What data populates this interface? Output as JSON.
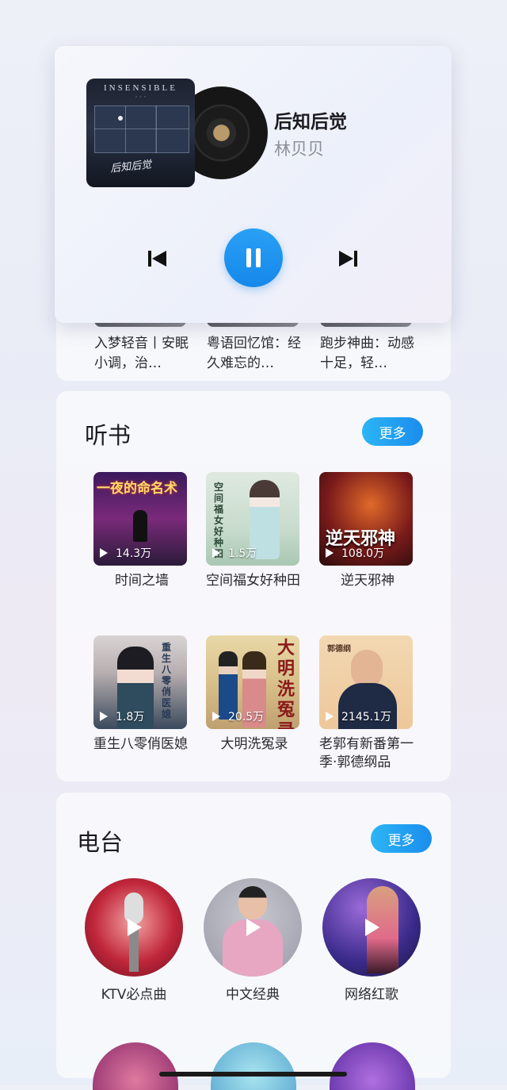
{
  "playlists": [
    {
      "title": "入梦轻音丨安眠小调，治…"
    },
    {
      "title": "粤语回忆馆：经久难忘的…"
    },
    {
      "title": "跑步神曲：动感十足，轻…"
    }
  ],
  "player": {
    "album_brand": "INSENSIBLE",
    "album_script": "后知后觉",
    "song_title": "后知后觉",
    "artist": "林贝贝",
    "prev_icon": "skip-previous-icon",
    "play_icon": "pause-icon",
    "next_icon": "skip-next-icon",
    "accent": "#1a8ded"
  },
  "books": {
    "title": "听书",
    "more": "更多",
    "items": [
      {
        "title": "时间之墙",
        "plays": "14.3万",
        "cover_text": "一夜的命名术"
      },
      {
        "title": "空间福女好种田",
        "plays": "1.5万",
        "cover_text": "空间福女好种田"
      },
      {
        "title": "逆天邪神",
        "plays": "108.0万",
        "cover_text": "逆天邪神"
      },
      {
        "title": "重生八零俏医媳",
        "plays": "1.8万",
        "cover_text": "重生八零俏医媳"
      },
      {
        "title": "大明洗冤录",
        "plays": "20.5万",
        "cover_text": "大明洗冤录"
      },
      {
        "title": "老郭有新番第一季·郭德纲品",
        "plays": "2145.1万",
        "cover_text": "郭德纲"
      }
    ]
  },
  "radio": {
    "title": "电台",
    "more": "更多",
    "items": [
      {
        "name": "KTV必点曲"
      },
      {
        "name": "中文经典"
      },
      {
        "name": "网络红歌"
      }
    ]
  }
}
